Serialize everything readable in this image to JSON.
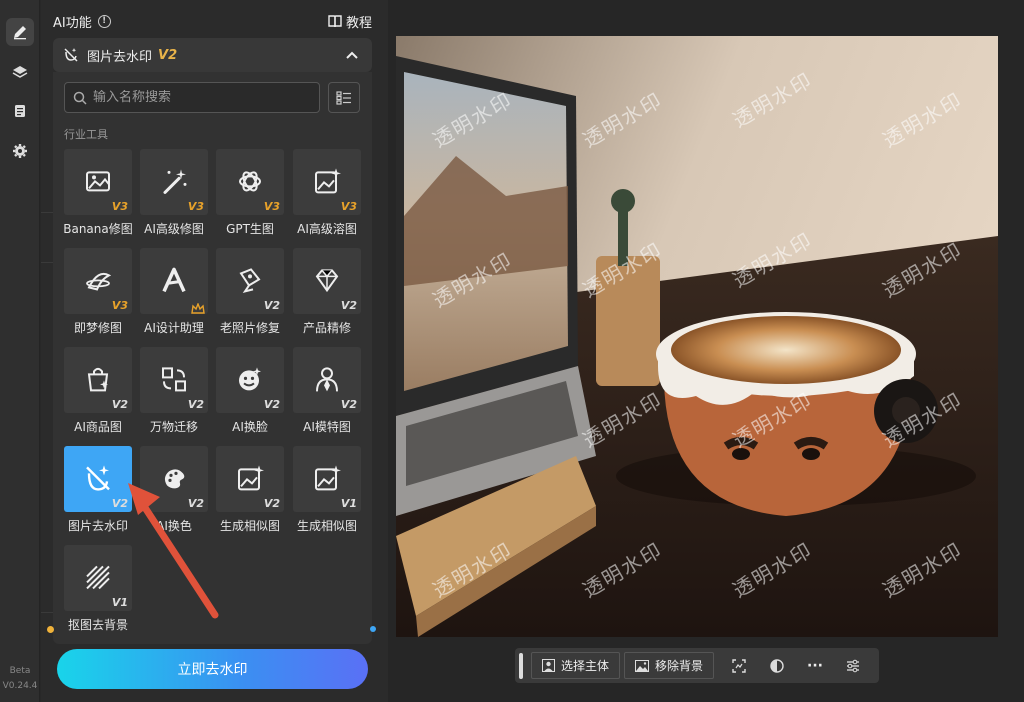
{
  "rail": {
    "version_line1": "Beta",
    "version_line2": "V0.24.4"
  },
  "panel": {
    "title": "AI功能",
    "info": "!",
    "tutorial_label": "教程"
  },
  "selector": {
    "label": "图片去水印",
    "version": "V2"
  },
  "search": {
    "placeholder": "输入名称搜索"
  },
  "section": {
    "label": "行业工具"
  },
  "tools": [
    {
      "label": "Banana修图",
      "version": "V3",
      "icon": "image-edit-icon"
    },
    {
      "label": "AI高级修图",
      "version": "V3",
      "icon": "magic-wand-icon"
    },
    {
      "label": "GPT生图",
      "version": "V3",
      "icon": "gpt-logo-icon"
    },
    {
      "label": "AI高级溶图",
      "version": "V3",
      "icon": "image-sparkle-icon"
    },
    {
      "label": "即梦修图",
      "version": "V3",
      "icon": "dream-icon"
    },
    {
      "label": "AI设计助理",
      "version": "",
      "icon": "design-assistant-icon"
    },
    {
      "label": "老照片修复",
      "version": "V2",
      "icon": "photo-repair-icon"
    },
    {
      "label": "产品精修",
      "version": "V2",
      "icon": "diamond-icon"
    },
    {
      "label": "AI商品图",
      "version": "V2",
      "icon": "shopping-bag-icon"
    },
    {
      "label": "万物迁移",
      "version": "V2",
      "icon": "transfer-icon"
    },
    {
      "label": "AI换脸",
      "version": "V2",
      "icon": "face-swap-icon"
    },
    {
      "label": "AI模特图",
      "version": "V2",
      "icon": "model-icon"
    },
    {
      "label": "图片去水印",
      "version": "V2",
      "icon": "watermark-remove-icon"
    },
    {
      "label": "AI换色",
      "version": "V2",
      "icon": "palette-icon"
    },
    {
      "label": "生成相似图",
      "version": "V2",
      "icon": "similar-image-icon"
    },
    {
      "label": "生成相似图",
      "version": "V1",
      "icon": "similar-image-icon"
    },
    {
      "label": "抠图去背景",
      "version": "V1",
      "icon": "cutout-icon"
    }
  ],
  "cta": {
    "label": "立即去水印"
  },
  "watermark": {
    "text": "透明水印"
  },
  "toolbar": {
    "select_subject": "选择主体",
    "remove_background": "移除背景",
    "more": "···"
  },
  "colors": {
    "accent": "#3ea6f5",
    "version_gold": "#e8a22a",
    "cta_start": "#19d4ea",
    "cta_end": "#5a70f5",
    "annotation_arrow": "#e0523a"
  }
}
